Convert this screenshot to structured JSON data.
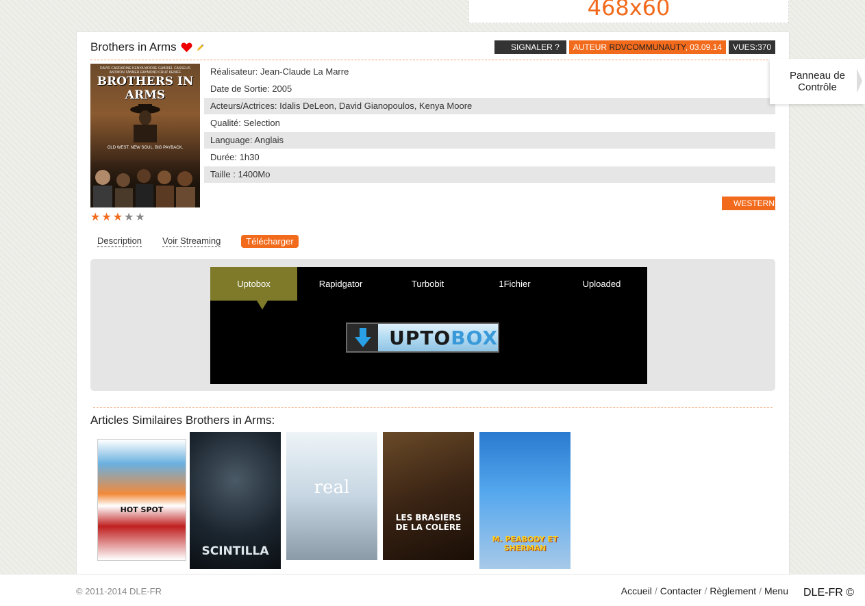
{
  "ad": {
    "text": "468x60"
  },
  "article": {
    "title": "Brothers in Arms",
    "badges": {
      "report": "SIGNALER ?",
      "author_label": "AUTEUR",
      "author": "RDVCOMMUNAUTY",
      "date": "03.09.14",
      "views": "VUES:370"
    },
    "poster": {
      "title": "BROTHERS IN ARMS",
      "cast": "DAVID CARRADINE  KENYA MOORE  GABRIEL CASSEUS  ANTWON TANNER  RAYMOND CRUZ  KENIFF",
      "tagline": "OLD WEST. NEW SOUL. BIG PAYBACK."
    },
    "rating": {
      "value": 3,
      "max": 5
    },
    "info": [
      "Réalisateur: Jean-Claude La Marre",
      "Date de Sortie: 2005",
      "Acteurs/Actrices: Idalis DeLeon, David Gianopoulos, Kenya Moore",
      "Qualité: Selection",
      "Language: Anglais",
      "Durée: 1h30",
      "Taille : 1400Mo"
    ],
    "genre": "WESTERN"
  },
  "tabs": [
    "Description",
    "Voir Streaming",
    "Télécharger"
  ],
  "hosts": [
    "Uptobox",
    "Rapidgator",
    "Turbobit",
    "1Fichier",
    "Uploaded"
  ],
  "download_button": {
    "part1": "UPTO",
    "part2": "BOX"
  },
  "similar": {
    "title": "Articles Similaires Brothers in Arms:",
    "items": [
      "HOT SPOT",
      "SCINTILLA",
      "real",
      "LES BRASIERS DE LA COLÈRE",
      "M. PEABODY ET SHERMAN"
    ]
  },
  "control_panel": {
    "line1": "Panneau de",
    "line2": "Contrôle"
  },
  "footer": {
    "copyright": "© 2011-2014 DLE-FR",
    "links": [
      "Accueil",
      "Contacter",
      "Règlement",
      "Menu"
    ],
    "brand": "DLE-FR ©"
  },
  "colors": {
    "accent": "#f26a1b",
    "dark": "#333333",
    "host_active": "#7e7a2a"
  }
}
